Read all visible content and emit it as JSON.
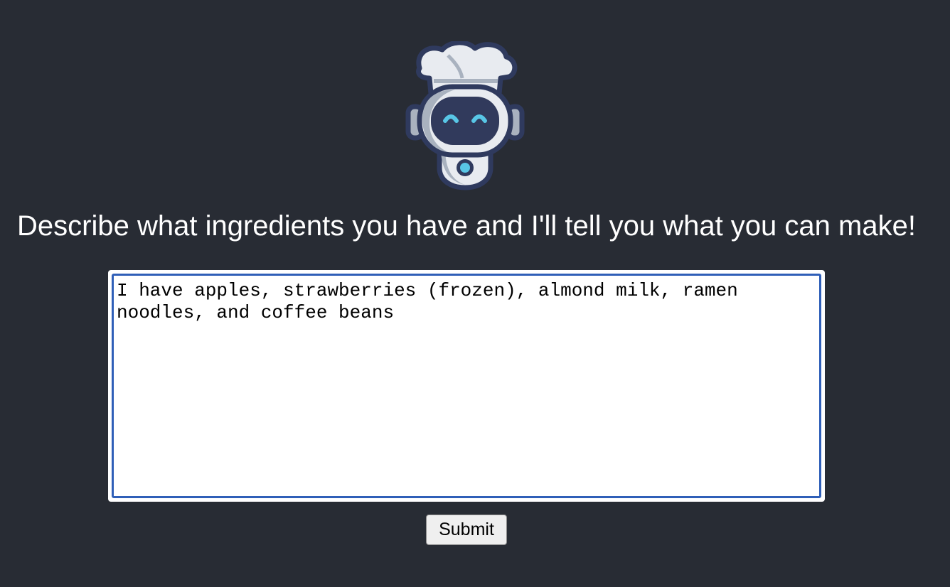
{
  "logo": {
    "icon": "chef-robot-icon",
    "colors": {
      "outline": "#2f3a5e",
      "body": "#e8ebf0",
      "shade": "#a9b2bf",
      "face": "#313a5c",
      "eyes": "#58c6e6"
    }
  },
  "main": {
    "heading": "Describe what ingredients you have and I'll tell you what you can make!",
    "ingredients_input": {
      "value": "I have apples, strawberries (frozen), almond milk, ramen noodles, and coffee beans",
      "placeholder": ""
    },
    "submit_label": "Submit"
  },
  "colors": {
    "background": "#282c34",
    "text": "#ffffff",
    "focus_ring": "#2f5fb8"
  }
}
